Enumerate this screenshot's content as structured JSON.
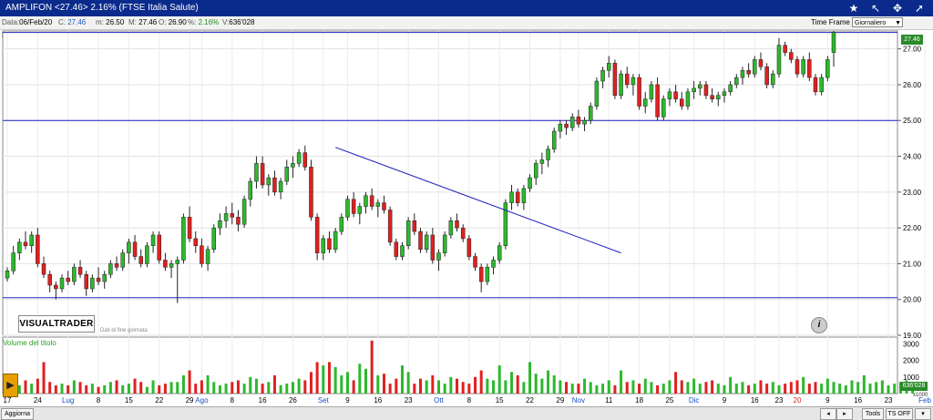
{
  "title_bar": {
    "text": "AMPLIFON <27.46> 2.16%    (FTSE Italia Salute)",
    "icons": [
      "star-icon",
      "arrow-icon",
      "crosshair-icon",
      "cursor-icon"
    ]
  },
  "info_bar": {
    "date_label": "Data:",
    "date": "06/Feb/20",
    "close_label": "C:",
    "close": "27.46",
    "min_label": "m:",
    "min": "26.50",
    "max_label": "M:",
    "max": "27.46",
    "open_label": "O:",
    "open": "26.90",
    "pct_label": "%:",
    "pct": "2.16%",
    "vol_label": "V:",
    "vol": "636'028"
  },
  "time_frame": {
    "label": "Time Frame",
    "value": "Giornaliero"
  },
  "branding": {
    "logo": "VISUALTRADER",
    "subtitle": "Dati di fine giornata"
  },
  "volume_panel": {
    "label": "Volume del titolo",
    "last_value": "636'028",
    "multiplier": "x1000"
  },
  "current_price_tag": "27.46",
  "bottom_bar": {
    "refresh": "Aggiorna",
    "tools": "Tools",
    "ts": "TS OFF"
  },
  "colors": {
    "up": "#2db82d",
    "down": "#e02020",
    "line": "#2020c0",
    "titlebar": "#0a2a8c"
  },
  "chart_data": {
    "type": "candlestick",
    "y_axis": {
      "min": 19.0,
      "max": 27.5,
      "ticks": [
        "19.00",
        "20.00",
        "21.00",
        "22.00",
        "23.00",
        "24.00",
        "25.00",
        "26.00",
        "27.00"
      ]
    },
    "volume_axis": {
      "ticks": [
        "1000",
        "2000",
        "3000"
      ]
    },
    "x_labels": [
      {
        "i": 0,
        "t": "17"
      },
      {
        "i": 5,
        "t": "24"
      },
      {
        "i": 10,
        "t": "Lug",
        "month": true
      },
      {
        "i": 15,
        "t": "8"
      },
      {
        "i": 20,
        "t": "15"
      },
      {
        "i": 25,
        "t": "22"
      },
      {
        "i": 30,
        "t": "29"
      },
      {
        "i": 32,
        "t": "Ago",
        "month": true
      },
      {
        "i": 37,
        "t": "8"
      },
      {
        "i": 42,
        "t": "16"
      },
      {
        "i": 47,
        "t": "26"
      },
      {
        "i": 52,
        "t": "Set",
        "month": true
      },
      {
        "i": 56,
        "t": "9"
      },
      {
        "i": 61,
        "t": "16"
      },
      {
        "i": 66,
        "t": "23"
      },
      {
        "i": 71,
        "t": "Ott",
        "month": true
      },
      {
        "i": 76,
        "t": "8"
      },
      {
        "i": 81,
        "t": "15"
      },
      {
        "i": 86,
        "t": "22"
      },
      {
        "i": 91,
        "t": "29"
      },
      {
        "i": 94,
        "t": "Nov",
        "month": true
      },
      {
        "i": 99,
        "t": "11"
      },
      {
        "i": 104,
        "t": "18"
      },
      {
        "i": 109,
        "t": "25"
      },
      {
        "i": 113,
        "t": "Dic",
        "month": true
      },
      {
        "i": 118,
        "t": "9"
      },
      {
        "i": 123,
        "t": "16"
      },
      {
        "i": 127,
        "t": "23"
      },
      {
        "i": 130,
        "t": "20",
        "red": true
      },
      {
        "i": 135,
        "t": "9"
      },
      {
        "i": 140,
        "t": "16"
      },
      {
        "i": 145,
        "t": "23"
      },
      {
        "i": 151,
        "t": "Feb",
        "month": true
      }
    ],
    "horizontal_lines": [
      27.46,
      25.0,
      20.05
    ],
    "trendline": {
      "from": [
        54,
        24.25
      ],
      "to": [
        101,
        21.3
      ]
    },
    "candles": [
      [
        20.6,
        20.9,
        20.5,
        20.8
      ],
      [
        20.8,
        21.5,
        20.7,
        21.3
      ],
      [
        21.3,
        21.7,
        21.1,
        21.6
      ],
      [
        21.6,
        21.9,
        21.4,
        21.5
      ],
      [
        21.5,
        21.9,
        21.3,
        21.8
      ],
      [
        21.8,
        22.0,
        20.9,
        21.0
      ],
      [
        21.0,
        21.2,
        20.6,
        20.7
      ],
      [
        20.7,
        20.8,
        20.2,
        20.4
      ],
      [
        20.4,
        20.5,
        20.0,
        20.3
      ],
      [
        20.3,
        20.7,
        20.2,
        20.6
      ],
      [
        20.6,
        20.8,
        20.4,
        20.5
      ],
      [
        20.5,
        21.0,
        20.4,
        20.9
      ],
      [
        20.9,
        21.1,
        20.6,
        20.7
      ],
      [
        20.7,
        20.8,
        20.1,
        20.3
      ],
      [
        20.3,
        20.7,
        20.2,
        20.6
      ],
      [
        20.6,
        20.9,
        20.4,
        20.5
      ],
      [
        20.5,
        20.8,
        20.3,
        20.7
      ],
      [
        20.7,
        21.1,
        20.6,
        21.0
      ],
      [
        21.0,
        21.2,
        20.8,
        20.9
      ],
      [
        20.9,
        21.4,
        20.8,
        21.3
      ],
      [
        21.3,
        21.7,
        21.0,
        21.6
      ],
      [
        21.6,
        21.8,
        21.1,
        21.2
      ],
      [
        21.2,
        21.4,
        20.9,
        21.0
      ],
      [
        21.0,
        21.6,
        20.9,
        21.5
      ],
      [
        21.5,
        21.9,
        21.3,
        21.8
      ],
      [
        21.8,
        21.9,
        21.0,
        21.1
      ],
      [
        21.1,
        21.3,
        20.8,
        20.9
      ],
      [
        20.9,
        21.1,
        20.6,
        21.0
      ],
      [
        21.0,
        21.2,
        19.9,
        21.1
      ],
      [
        21.1,
        22.4,
        21.0,
        22.3
      ],
      [
        22.3,
        22.6,
        21.6,
        21.7
      ],
      [
        21.7,
        21.9,
        21.3,
        21.5
      ],
      [
        21.5,
        21.7,
        20.9,
        21.0
      ],
      [
        21.0,
        21.5,
        20.8,
        21.4
      ],
      [
        21.4,
        22.1,
        21.3,
        22.0
      ],
      [
        22.0,
        22.4,
        21.8,
        22.2
      ],
      [
        22.2,
        22.6,
        22.0,
        22.4
      ],
      [
        22.4,
        22.7,
        22.1,
        22.3
      ],
      [
        22.3,
        22.5,
        21.9,
        22.1
      ],
      [
        22.1,
        22.9,
        22.0,
        22.8
      ],
      [
        22.8,
        23.4,
        22.6,
        23.3
      ],
      [
        23.3,
        24.0,
        23.1,
        23.8
      ],
      [
        23.8,
        24.0,
        23.1,
        23.2
      ],
      [
        23.2,
        23.5,
        22.9,
        23.4
      ],
      [
        23.4,
        23.6,
        22.9,
        23.0
      ],
      [
        23.0,
        23.4,
        22.8,
        23.3
      ],
      [
        23.3,
        23.9,
        23.2,
        23.7
      ],
      [
        23.7,
        24.0,
        23.4,
        23.8
      ],
      [
        23.8,
        24.2,
        23.7,
        24.1
      ],
      [
        24.1,
        24.3,
        23.6,
        23.7
      ],
      [
        23.7,
        23.9,
        22.2,
        22.3
      ],
      [
        22.3,
        22.4,
        21.1,
        21.3
      ],
      [
        21.3,
        21.8,
        21.1,
        21.7
      ],
      [
        21.7,
        21.9,
        21.3,
        21.4
      ],
      [
        21.4,
        22.0,
        21.3,
        21.9
      ],
      [
        21.9,
        22.4,
        21.8,
        22.3
      ],
      [
        22.3,
        22.9,
        22.2,
        22.8
      ],
      [
        22.8,
        23.0,
        22.3,
        22.4
      ],
      [
        22.4,
        22.7,
        22.1,
        22.6
      ],
      [
        22.6,
        23.0,
        22.4,
        22.9
      ],
      [
        22.9,
        23.1,
        22.5,
        22.6
      ],
      [
        22.6,
        22.8,
        22.3,
        22.7
      ],
      [
        22.7,
        22.9,
        22.4,
        22.5
      ],
      [
        22.5,
        22.6,
        21.5,
        21.6
      ],
      [
        21.6,
        21.7,
        21.1,
        21.2
      ],
      [
        21.2,
        21.6,
        21.1,
        21.5
      ],
      [
        21.5,
        22.3,
        21.4,
        22.2
      ],
      [
        22.2,
        22.4,
        21.8,
        21.9
      ],
      [
        21.9,
        22.0,
        21.3,
        21.4
      ],
      [
        21.4,
        21.9,
        21.3,
        21.8
      ],
      [
        21.8,
        22.0,
        21.0,
        21.1
      ],
      [
        21.1,
        21.4,
        20.8,
        21.3
      ],
      [
        21.3,
        21.9,
        21.2,
        21.8
      ],
      [
        21.8,
        22.3,
        21.7,
        22.2
      ],
      [
        22.2,
        22.4,
        21.9,
        22.0
      ],
      [
        22.0,
        22.1,
        21.6,
        21.7
      ],
      [
        21.7,
        21.8,
        21.1,
        21.2
      ],
      [
        21.2,
        21.3,
        20.8,
        20.9
      ],
      [
        20.9,
        21.0,
        20.2,
        20.5
      ],
      [
        20.5,
        21.0,
        20.4,
        20.9
      ],
      [
        20.9,
        21.2,
        20.7,
        21.1
      ],
      [
        21.1,
        21.6,
        21.0,
        21.5
      ],
      [
        21.5,
        22.8,
        21.4,
        22.7
      ],
      [
        22.7,
        23.2,
        22.5,
        23.0
      ],
      [
        23.0,
        23.1,
        22.6,
        22.7
      ],
      [
        22.7,
        23.2,
        22.5,
        23.1
      ],
      [
        23.1,
        23.5,
        23.0,
        23.4
      ],
      [
        23.4,
        23.9,
        23.2,
        23.8
      ],
      [
        23.8,
        24.1,
        23.5,
        23.9
      ],
      [
        23.9,
        24.3,
        23.7,
        24.2
      ],
      [
        24.2,
        24.8,
        24.1,
        24.7
      ],
      [
        24.7,
        25.0,
        24.5,
        24.9
      ],
      [
        24.9,
        25.0,
        24.6,
        24.8
      ],
      [
        24.8,
        25.2,
        24.7,
        25.1
      ],
      [
        25.1,
        25.3,
        24.8,
        24.9
      ],
      [
        24.9,
        25.1,
        24.7,
        25.0
      ],
      [
        25.0,
        25.5,
        24.9,
        25.4
      ],
      [
        25.4,
        26.2,
        25.3,
        26.1
      ],
      [
        26.1,
        26.5,
        25.9,
        26.4
      ],
      [
        26.4,
        26.8,
        26.2,
        26.6
      ],
      [
        26.6,
        26.7,
        25.6,
        25.7
      ],
      [
        25.7,
        26.4,
        25.6,
        26.3
      ],
      [
        26.3,
        26.5,
        25.9,
        26.0
      ],
      [
        26.0,
        26.3,
        25.7,
        26.2
      ],
      [
        26.2,
        26.3,
        25.3,
        25.4
      ],
      [
        25.4,
        25.8,
        25.2,
        25.6
      ],
      [
        25.6,
        26.1,
        25.5,
        26.0
      ],
      [
        26.0,
        26.2,
        25.0,
        25.1
      ],
      [
        25.1,
        25.7,
        25.0,
        25.6
      ],
      [
        25.6,
        25.9,
        25.4,
        25.8
      ],
      [
        25.8,
        26.0,
        25.5,
        25.6
      ],
      [
        25.6,
        25.8,
        25.3,
        25.4
      ],
      [
        25.4,
        25.9,
        25.3,
        25.8
      ],
      [
        25.8,
        26.1,
        25.6,
        25.9
      ],
      [
        25.9,
        26.1,
        25.7,
        26.0
      ],
      [
        26.0,
        26.1,
        25.6,
        25.7
      ],
      [
        25.7,
        25.9,
        25.5,
        25.6
      ],
      [
        25.6,
        25.8,
        25.4,
        25.7
      ],
      [
        25.7,
        25.9,
        25.5,
        25.8
      ],
      [
        25.8,
        26.1,
        25.7,
        26.0
      ],
      [
        26.0,
        26.3,
        25.9,
        26.2
      ],
      [
        26.2,
        26.5,
        26.0,
        26.4
      ],
      [
        26.4,
        26.6,
        26.2,
        26.3
      ],
      [
        26.3,
        26.8,
        26.2,
        26.7
      ],
      [
        26.7,
        26.9,
        26.4,
        26.5
      ],
      [
        26.5,
        26.6,
        25.9,
        26.0
      ],
      [
        26.0,
        26.4,
        25.9,
        26.3
      ],
      [
        26.3,
        27.3,
        26.2,
        27.1
      ],
      [
        27.1,
        27.2,
        26.8,
        26.9
      ],
      [
        26.9,
        27.0,
        26.6,
        26.7
      ],
      [
        26.7,
        26.8,
        26.2,
        26.3
      ],
      [
        26.3,
        26.8,
        26.2,
        26.7
      ],
      [
        26.7,
        26.9,
        26.1,
        26.2
      ],
      [
        26.2,
        26.3,
        25.7,
        25.8
      ],
      [
        25.8,
        26.3,
        25.7,
        26.2
      ],
      [
        26.2,
        26.8,
        26.1,
        26.7
      ],
      [
        26.9,
        27.5,
        26.5,
        27.46
      ]
    ],
    "volumes": [
      600,
      700,
      500,
      800,
      600,
      900,
      1900,
      700,
      500,
      600,
      500,
      800,
      700,
      500,
      600,
      400,
      500,
      700,
      800,
      500,
      600,
      900,
      700,
      400,
      800,
      500,
      600,
      700,
      700,
      1100,
      1400,
      600,
      800,
      1100,
      700,
      500,
      600,
      700,
      800,
      600,
      1000,
      900,
      600,
      700,
      1100,
      500,
      600,
      700,
      900,
      800,
      1300,
      1900,
      1700,
      1900,
      1600,
      1100,
      1300,
      800,
      1800,
      1500,
      3200,
      1100,
      1200,
      600,
      900,
      1700,
      1300,
      600,
      900,
      800,
      1100,
      800,
      600,
      1000,
      900,
      700,
      600,
      1000,
      1400,
      900,
      800,
      1700,
      800,
      1300,
      1100,
      700,
      1900,
      1200,
      900,
      1400,
      1100,
      800,
      700,
      600,
      600,
      900,
      700,
      500,
      600,
      800,
      500,
      1400,
      700,
      800,
      600,
      900,
      700,
      500,
      600,
      800,
      1300,
      800,
      700,
      900,
      600,
      700,
      800,
      600,
      500,
      1000,
      600,
      700,
      500,
      600,
      800,
      600,
      700,
      500,
      600,
      700,
      800,
      1000,
      600,
      700,
      600,
      900,
      700,
      600,
      500,
      800,
      700,
      1100,
      600,
      700,
      800,
      500,
      600,
      700,
      800,
      650
    ]
  }
}
